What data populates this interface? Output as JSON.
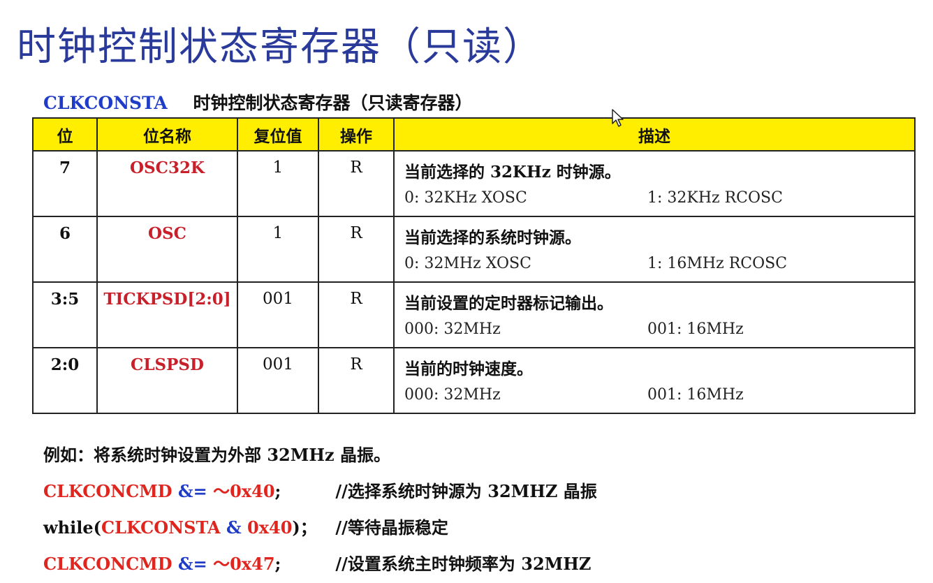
{
  "slide": {
    "title": "时钟控制状态寄存器（只读）"
  },
  "register": {
    "name": "CLKCONSTA",
    "description": "时钟控制状态寄存器（只读寄存器）"
  },
  "table": {
    "headers": [
      "位",
      "位名称",
      "复位值",
      "操作",
      "描述"
    ],
    "rows": [
      {
        "bit": "7",
        "name": "OSC32K",
        "reset": "1",
        "op": "R",
        "desc": "当前选择的 32KHz 时钟源。",
        "opt0": "0: 32KHz XOSC",
        "opt1": "1: 32KHz RCOSC"
      },
      {
        "bit": "6",
        "name": "OSC",
        "reset": "1",
        "op": "R",
        "desc": "当前选择的系统时钟源。",
        "opt0": "0: 32MHz XOSC",
        "opt1": "1: 16MHz RCOSC"
      },
      {
        "bit": "3:5",
        "name": "TICKPSD[2:0]",
        "reset": "001",
        "op": "R",
        "desc": "当前设置的定时器标记输出。",
        "opt0": "000: 32MHz",
        "opt1": "001: 16MHz"
      },
      {
        "bit": "2:0",
        "name": "CLSPSD",
        "reset": "001",
        "op": "R",
        "desc": "当前的时钟速度。",
        "opt0": "000: 32MHz",
        "opt1": "001: 16MHz"
      }
    ]
  },
  "example": {
    "intro": "例如：将系统时钟设置为外部 32MHz 晶振。",
    "line1": {
      "reg": "CLKCONCMD",
      "op": " &= ",
      "val": "～0x40",
      "end": ";",
      "comment": "//选择系统时钟源为 32MHZ 晶振"
    },
    "line2": {
      "kw": "while(",
      "reg": "CLKCONSTA",
      "op": " & ",
      "val": "0x40",
      "end": ")；",
      "comment": "//等待晶振稳定"
    },
    "line3": {
      "reg": "CLKCONCMD",
      "op": " &= ",
      "val": "～0x47",
      "end": ";",
      "comment": "//设置系统主时钟频率为 32MHZ"
    }
  }
}
